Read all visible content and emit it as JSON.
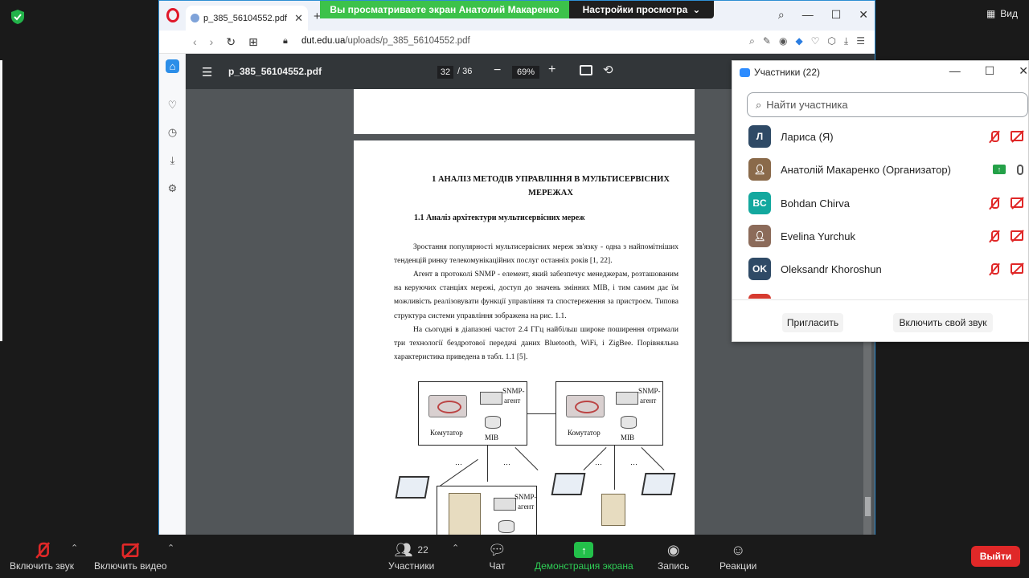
{
  "zoom": {
    "view_label": "Вид",
    "share_banner": "Вы просматриваете экран Анатолий Макаренко",
    "view_settings": "Настройки просмотра",
    "toolbar": {
      "unmute": "Включить звук",
      "start_video": "Включить видео",
      "participants": "Участники",
      "participants_count": "22",
      "chat": "Чат",
      "share": "Демонстрация экрана",
      "record": "Запись",
      "reactions": "Реакции",
      "leave": "Выйти"
    }
  },
  "browser": {
    "tab_title": "p_385_56104552.pdf",
    "url_domain": "dut.edu.ua",
    "url_path": "/uploads/p_385_56104552.pdf"
  },
  "pdf": {
    "file_name": "p_385_56104552.pdf",
    "current_page": "32",
    "total_pages": "/ 36",
    "zoom": "69%",
    "heading": "1 АНАЛІЗ МЕТОДІВ УПРАВЛІННЯ В МУЛЬТИСЕРВІСНИХ МЕРЕЖАХ",
    "subheading": "1.1 Аналіз архітектури мультисервісних мереж",
    "paragraph1": "Зростання популярності мультисервісних мереж зв'язку - одна з найпомітніших тенденцій ринку телекомунікаційних послуг останніх років [1, 22].",
    "paragraph2": "Агент в протоколі SNMP - елемент, який забезпечує менеджерам, розташованим на керуючих станціях мережі, доступ до значень змінних MIB, і тим самим дає їм можливість реалізовувати функції управління та спостереження за пристроєм. Типова структура системи управління зображена на рис. 1.1.",
    "paragraph3": "На сьогодні в діапазоні частот 2.4 ГГц найбільш широке поширення отримали три технології бездротової передачі даних Bluetooth, WiFi, і ZigBee. Порівняльна характеристика приведена в табл. 1.1 [5].",
    "diagram": {
      "switch_label": "Комутатор",
      "mib_label": "MIB",
      "agent_label_1": "SNMP-",
      "agent_label_2": "агент",
      "dots": "…"
    }
  },
  "participants_panel": {
    "title": "Участники (22)",
    "search_placeholder": "Найти участника",
    "items": [
      {
        "initials": "Л",
        "name": "Лариса (Я)",
        "color": "#2f4a66",
        "mic": "off",
        "video": "off"
      },
      {
        "initials": "",
        "name": "Анатолій Макаренко (Организатор)",
        "color": "#8a6a4a",
        "mic": "on",
        "video": "sharing"
      },
      {
        "initials": "BC",
        "name": "Bohdan Chirva",
        "color": "#13a89e",
        "mic": "off",
        "video": "off"
      },
      {
        "initials": "",
        "name": "Evelina Yurchuk",
        "color": "#8c6b5a",
        "mic": "off",
        "video": "off"
      },
      {
        "initials": "OK",
        "name": "Oleksandr Khoroshun",
        "color": "#2f4a66",
        "mic": "off",
        "video": "off"
      }
    ],
    "invite": "Пригласить",
    "unmute_self": "Включить свой звук"
  }
}
